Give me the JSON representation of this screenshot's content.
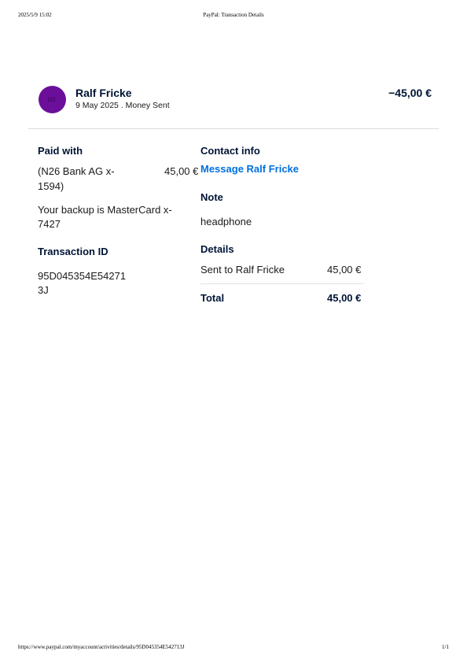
{
  "print_header": {
    "datetime": "2025/5/9 15:02",
    "title": "PayPal: Transaction Details"
  },
  "print_footer": {
    "url": "https://www.paypal.com/myaccount/activities/details/95D045354E542713J",
    "page": "1/1"
  },
  "transaction": {
    "avatar_initials": "RF",
    "avatar_color": "#6b0f9b",
    "name": "Ralf Fricke",
    "subline": "9 May 2025 . Money Sent",
    "amount": "−45,00 €"
  },
  "paid_with": {
    "heading": "Paid with",
    "source_line1": "(N26 Bank AG x-",
    "source_line2": "1594)",
    "source_amount": "45,00 €",
    "backup_line1": "Your backup is MasterCard x-",
    "backup_line2": "7427"
  },
  "transaction_id": {
    "heading": "Transaction ID",
    "line1": "95D045354E54271",
    "line2": "3J"
  },
  "contact": {
    "heading": "Contact info",
    "link": "Message Ralf Fricke",
    "link_color": "#0070e0"
  },
  "note": {
    "heading": "Note",
    "text": "headphone"
  },
  "details": {
    "heading": "Details",
    "sent_label": "Sent to Ralf Fricke",
    "sent_amount": "45,00 €",
    "total_label": "Total",
    "total_amount": "45,00 €"
  }
}
